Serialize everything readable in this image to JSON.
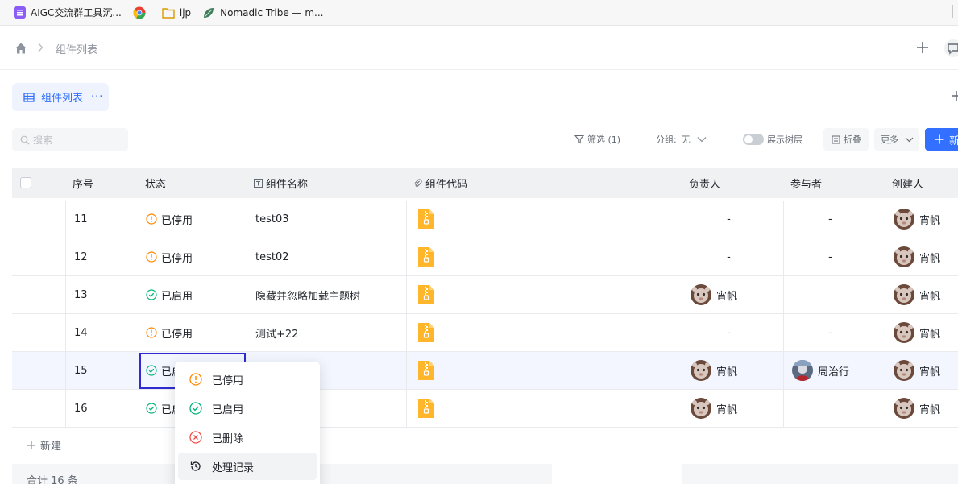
{
  "bookmarks": [
    {
      "icon": "list-app-icon",
      "label": "AIGC交流群工具沉..."
    },
    {
      "icon": "chrome-icon",
      "label": ""
    },
    {
      "icon": "folder-icon",
      "label": "ljp"
    },
    {
      "icon": "leaf-icon",
      "label": "Nomadic Tribe — m..."
    }
  ],
  "topnav": {
    "breadcrumb": "组件列表"
  },
  "view": {
    "tab_label": "组件列表",
    "more": "···"
  },
  "toolbar": {
    "search_placeholder": "搜索",
    "filter_label": "筛选 (1)",
    "group_label": "分组:",
    "group_value": "无",
    "tree_label": "展示树层",
    "fold_label": "折叠",
    "more_label": "更多",
    "new_label": "新"
  },
  "table": {
    "columns": {
      "no": "序号",
      "status": "状态",
      "name": "组件名称",
      "code": "组件代码",
      "owner": "负责人",
      "participant": "参与者",
      "creator": "创建人"
    },
    "rows": [
      {
        "no": "11",
        "status": "已停用",
        "status_kind": "disabled",
        "name": "test03",
        "owner": "-",
        "participant": "-",
        "creator": "宵帆"
      },
      {
        "no": "12",
        "status": "已停用",
        "status_kind": "disabled",
        "name": "test02",
        "owner": "-",
        "participant": "-",
        "creator": "宵帆"
      },
      {
        "no": "13",
        "status": "已启用",
        "status_kind": "enabled",
        "name": "隐藏并忽略加载主题树",
        "owner": "宵帆",
        "participant": "",
        "creator": "宵帆"
      },
      {
        "no": "14",
        "status": "已停用",
        "status_kind": "disabled",
        "name": "测试+22",
        "owner": "-",
        "participant": "-",
        "creator": "宵帆"
      },
      {
        "no": "15",
        "status": "已启",
        "status_kind": "enabled",
        "name": "",
        "owner": "宵帆",
        "participant": "周治行",
        "creator": "宵帆"
      },
      {
        "no": "16",
        "status": "已启",
        "status_kind": "enabled",
        "name": "",
        "owner": "宵帆",
        "participant": "",
        "creator": "宵帆"
      }
    ],
    "new_row_label": "新建",
    "footer": "合计 16 条"
  },
  "status_menu": {
    "items": [
      {
        "label": "已停用",
        "icon": "warning-circle-icon"
      },
      {
        "label": "已启用",
        "icon": "check-circle-icon"
      },
      {
        "label": "已删除",
        "icon": "x-circle-icon"
      },
      {
        "label": "处理记录",
        "icon": "history-icon"
      }
    ]
  },
  "colors": {
    "accent": "#3370ff",
    "warning": "#ff8800",
    "success": "#00b578",
    "danger": "#f54a45",
    "file": "#ffb62b"
  }
}
